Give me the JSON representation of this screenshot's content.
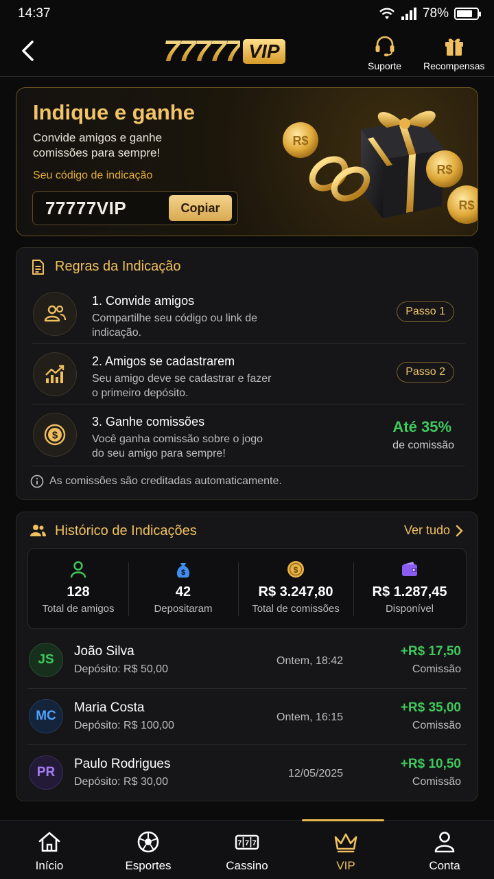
{
  "status": {
    "time": "14:37",
    "battery_pct": 78,
    "battery_label": "78%"
  },
  "header": {
    "logo_num": "77777",
    "logo_badge": "VIP",
    "support_label": "Suporte",
    "rewards_label": "Recompensas"
  },
  "banner": {
    "title": "Indique e ganhe",
    "subtitle": "Convide amigos e ganhe comissões para sempre!",
    "code_label": "Seu código de indicação",
    "code": "77777VIP",
    "copy_label": "Copiar"
  },
  "rules": {
    "title": "Regras da Indicação",
    "items": [
      {
        "title": "1. Convide amigos",
        "desc": "Compartilhe seu código ou link de indicação.",
        "badge": "Passo 1"
      },
      {
        "title": "2. Amigos se cadastrarem",
        "desc": "Seu amigo deve se cadastrar e fazer o primeiro depósito.",
        "badge": "Passo 2"
      },
      {
        "title": "3. Ganhe comissões",
        "desc": "Você ganha comissão sobre o jogo do seu amigo para sempre!",
        "highlight": "Até 35%",
        "highlight_label": "de comissão"
      }
    ],
    "note": "As comissões são creditadas automaticamente."
  },
  "history": {
    "title": "Histórico de Indicações",
    "see_all": "Ver tudo",
    "stats": [
      {
        "value": "128",
        "label": "Total de amigos",
        "icon": "user-icon"
      },
      {
        "value": "42",
        "label": "Depositaram",
        "icon": "money-bag-icon"
      },
      {
        "value": "R$ 3.247,80",
        "label": "Total de comissões",
        "icon": "coin-icon"
      },
      {
        "value": "R$ 1.287,45",
        "label": "Disponível",
        "icon": "wallet-icon"
      }
    ],
    "rows": [
      {
        "initials": "JS",
        "name": "João Silva",
        "deposit": "Depósito: R$ 50,00",
        "date": "Ontem, 18:42",
        "amount": "+R$ 17,50",
        "amount_label": "Comissão",
        "color": "#3fca5c"
      },
      {
        "initials": "MC",
        "name": "Maria Costa",
        "deposit": "Depósito: R$ 100,00",
        "date": "Ontem, 16:15",
        "amount": "+R$ 35,00",
        "amount_label": "Comissão",
        "color": "#4ea3ff"
      },
      {
        "initials": "PR",
        "name": "Paulo Rodrigues",
        "deposit": "Depósito: R$ 30,00",
        "date": "12/05/2025",
        "amount": "+R$ 10,50",
        "amount_label": "Comissão",
        "color": "#a67cf5"
      }
    ]
  },
  "nav": {
    "items": [
      {
        "label": "Início",
        "icon": "home-icon"
      },
      {
        "label": "Esportes",
        "icon": "soccer-ball-icon"
      },
      {
        "label": "Cassino",
        "icon": "slot-777-icon"
      },
      {
        "label": "VIP",
        "icon": "crown-icon",
        "active": true
      },
      {
        "label": "Conta",
        "icon": "person-icon"
      }
    ]
  },
  "colors": {
    "gold": "#f0c060",
    "green": "#3fca5c",
    "background": "#0b0b0c"
  }
}
